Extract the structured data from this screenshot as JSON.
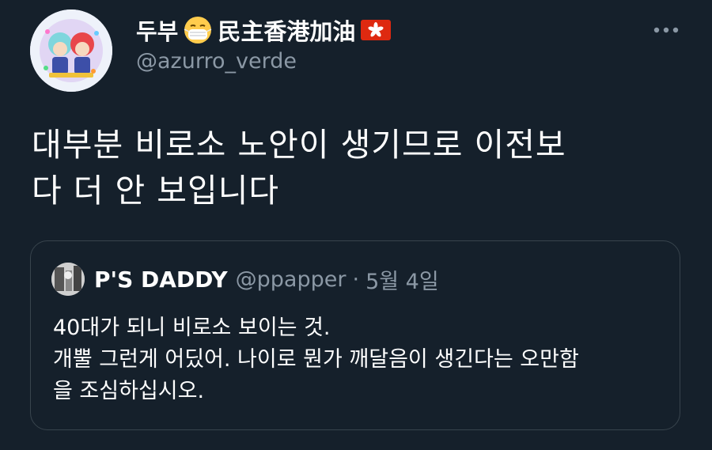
{
  "author": {
    "display_name": "두부",
    "display_name_suffix": "民主香港加油",
    "handle": "@azurro_verde",
    "emoji_icons": [
      "face-with-medical-mask",
      "hong-kong-flag"
    ]
  },
  "tweet": {
    "lines": [
      "대부분 비로소 노안이 생기므로 이전보",
      "다 더 안 보입니다"
    ]
  },
  "quoted_tweet": {
    "display_name": "P'S DADDY",
    "handle": "@ppapper",
    "separator": "·",
    "date": "5월 4일",
    "lines": [
      "40대가 되니 비로소 보이는 것.",
      "개뿔 그런게 어딨어. 나이로 뭔가 깨달음이 생긴다는 오만함",
      "을 조심하십시오."
    ]
  },
  "colors": {
    "background": "#15202b",
    "primary_text": "#ffffff",
    "secondary_text": "#8b98a5",
    "border": "#38444d"
  }
}
